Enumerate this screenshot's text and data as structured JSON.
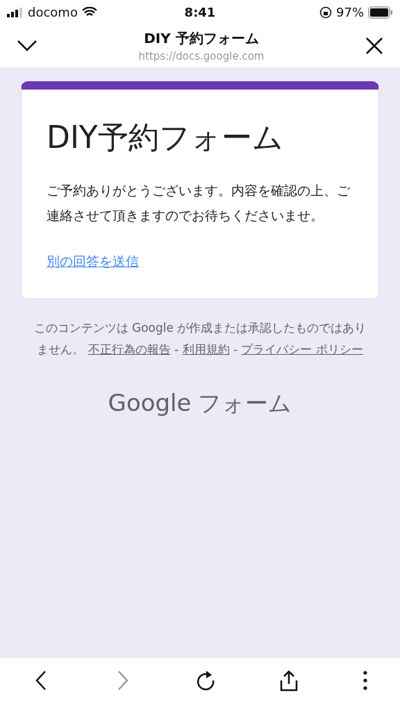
{
  "status_bar": {
    "carrier": "docomo",
    "time": "8:41",
    "battery": "97%"
  },
  "header": {
    "title": "DIY 予約フォーム",
    "url": "https://docs.google.com"
  },
  "form": {
    "title": "DIY予約フォーム",
    "message": "ご予約ありがとうございます。内容を確認の上、ご連絡させて頂きますのでお待ちくださいませ。",
    "link": "別の回答を送信"
  },
  "footer": {
    "notice": "このコンテンツは Google が作成または承認したものではありません。",
    "separator": "-",
    "links": [
      {
        "label": "不正行為の報告"
      },
      {
        "label": "利用規約"
      },
      {
        "label": "プライバシー ポリシー"
      }
    ]
  },
  "brand": {
    "name": "Google",
    "product": "フォーム"
  },
  "toolbar": [
    {
      "kind": "back",
      "disabled": false
    },
    {
      "kind": "forward",
      "disabled": true
    },
    {
      "kind": "reload",
      "disabled": false
    },
    {
      "kind": "share",
      "disabled": false
    },
    {
      "kind": "more",
      "disabled": false
    }
  ]
}
